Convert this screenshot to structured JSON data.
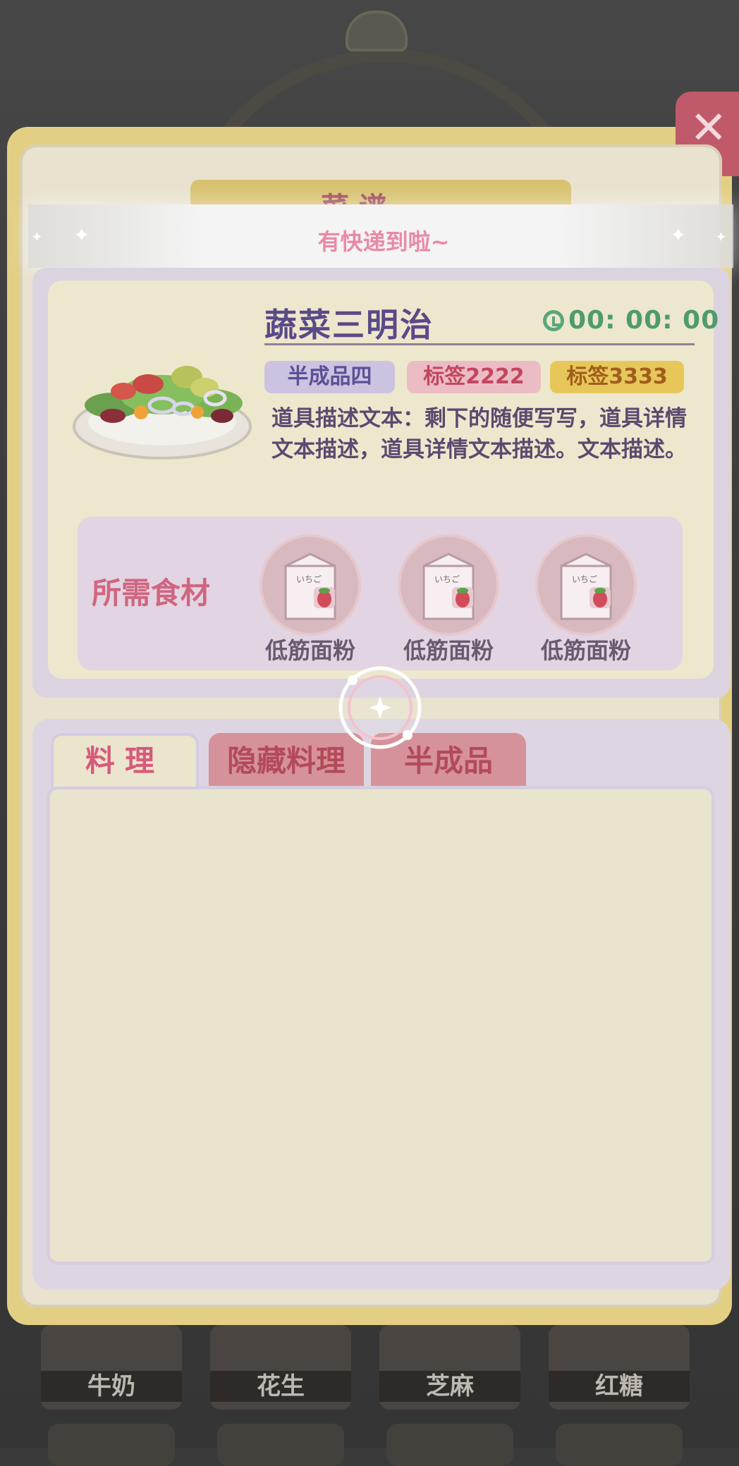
{
  "popup": {
    "title": "菜 谱",
    "close_label": "✕"
  },
  "toast": {
    "text": "有快递到啦~"
  },
  "item": {
    "name": "蔬菜三明治",
    "timer": "00: 00: 00",
    "tags": [
      "半成品四",
      "标签2222",
      "标签3333"
    ],
    "description": "道具描述文本：剩下的随便写写，道具详情文本描述，道具详情文本描述。文本描述。"
  },
  "ingredients": {
    "title": "所需食材",
    "items": [
      {
        "name": "低筋面粉",
        "icon": "milk-carton-strawberry"
      },
      {
        "name": "低筋面粉",
        "icon": "milk-carton-strawberry"
      },
      {
        "name": "低筋面粉",
        "icon": "milk-carton-strawberry"
      }
    ]
  },
  "tabs": [
    "料理",
    "隐藏料理",
    "半成品"
  ],
  "active_tab": "料理",
  "background_shelf": [
    "牛奶",
    "花生",
    "芝麻",
    "红糖"
  ],
  "colors": {
    "panel_border": "#e2cf83",
    "accent_pink": "#d65a7a",
    "timer_green": "#4f9b6a",
    "name_purple": "#5a4a88"
  }
}
